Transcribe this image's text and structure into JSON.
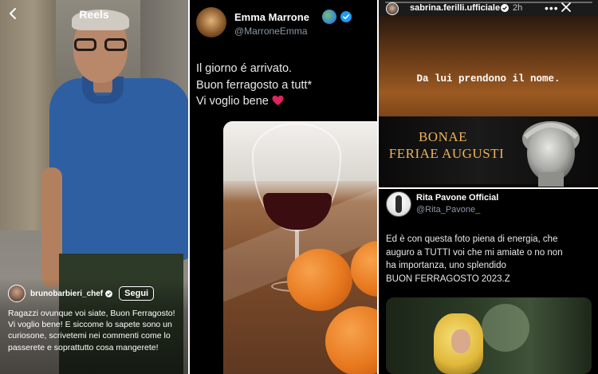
{
  "reels": {
    "title": "Reels",
    "username": "brunobarbieri_chef",
    "follow_label": "Segui",
    "caption": "Ragazzi ovunque voi siate, Buon Ferragosto! Vi voglio bene! E siccome lo sapete sono un curiosone, scrivetemi nei commenti come lo passerete e soprattutto cosa mangerete!"
  },
  "emma_tweet": {
    "name": "Emma Marrone",
    "handle": "@MarroneEmma",
    "lines": [
      "Il giorno é arrivato.",
      "Buon ferragosto a tutt*",
      "Vi voglio bene"
    ],
    "emoji_globe": "globe-icon",
    "emoji_heart": "heart-icon",
    "verified_color": "#1d9bf0"
  },
  "story": {
    "username": "sabrina.ferilli.ufficiale",
    "time": "2h",
    "quote": "Da lui prendono il nome.",
    "title_line1": "BONAE",
    "title_line2": "FERIAE AUGUSTI",
    "accent_color": "#f0b25c"
  },
  "rita_tweet": {
    "name": "Rita Pavone Official",
    "handle": "@Rita_Pavone_",
    "lines": [
      "Ed è  con questa foto piena di energia, che",
      "auguro a TUTTI voi  che mi amiate o no non",
      "ha importanza, uno splendido",
      "BUON FERRAGOSTO 2023.Z"
    ]
  }
}
